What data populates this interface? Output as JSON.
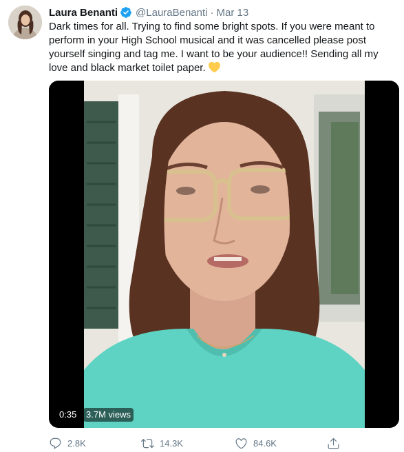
{
  "tweet": {
    "author": {
      "display_name": "Laura Benanti",
      "handle": "@LauraBenanti",
      "verified": true
    },
    "separator": "·",
    "date": "Mar 13",
    "text": "Dark times for all. Trying to find some bright spots. If you were meant to perform in your High School musical and it was cancelled please post yourself singing and tag me. I want to be your audience!! Sending all my love and black market toilet paper.",
    "emoji": "yellow-heart",
    "video": {
      "duration": "0:35",
      "views": "3.7M views"
    },
    "actions": {
      "replies": "2.8K",
      "retweets": "14.3K",
      "likes": "84.6K"
    }
  },
  "colors": {
    "text": "#14171a",
    "secondary": "#657786",
    "verified": "#1da1f2",
    "heart_emoji": "#ffcc4d",
    "shirt": "#5fd3c3"
  }
}
